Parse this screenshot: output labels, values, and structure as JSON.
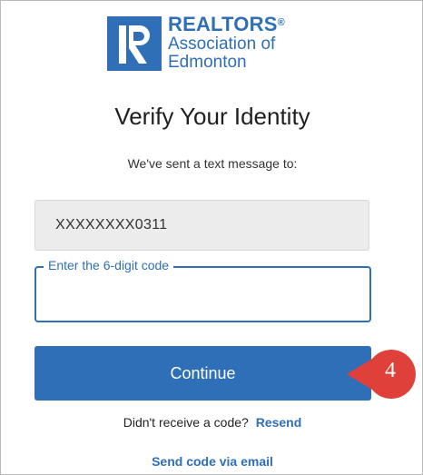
{
  "logo": {
    "line1": "REALTORS",
    "registered": "®",
    "line2": "Association of",
    "line3": "Edmonton"
  },
  "page": {
    "title": "Verify Your Identity",
    "subtitle": "We've sent a text message to:"
  },
  "phone": {
    "masked_number": "XXXXXXXX0311"
  },
  "code_field": {
    "label": "Enter the 6-digit code",
    "value": ""
  },
  "continue_button": {
    "label": "Continue"
  },
  "callout": {
    "number": "4"
  },
  "resend": {
    "prompt": "Didn't receive a code?",
    "link": "Resend"
  },
  "email_link": {
    "label": "Send code via email"
  },
  "colors": {
    "brand_blue": "#2f6fb7",
    "callout_red": "#e0403a",
    "phone_box_bg": "#ececec"
  }
}
